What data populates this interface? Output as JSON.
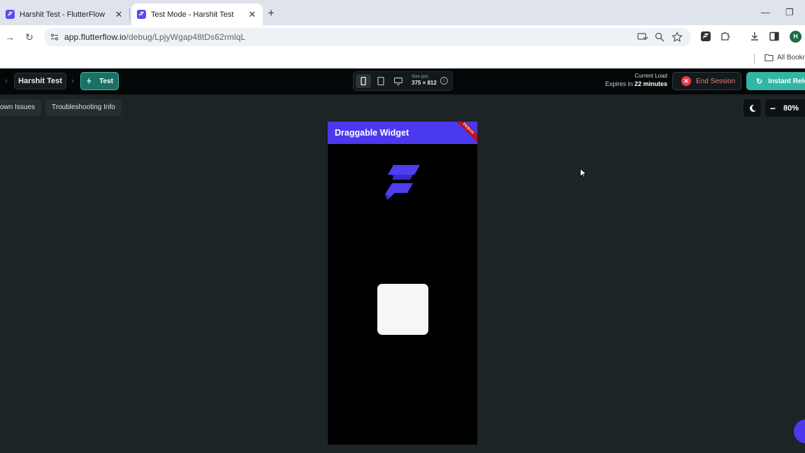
{
  "browser": {
    "tabs": [
      {
        "title": "Harshit Test - FlutterFlow",
        "active": false
      },
      {
        "title": "Test Mode - Harshit Test",
        "active": true
      }
    ],
    "url_host": "app.flutterflow.io",
    "url_path": "/debug/LpjyWgap48tDs62rmlqL",
    "profile_initial": "H",
    "bookmarks_label": "All Bookm"
  },
  "ff_header": {
    "project_name": "Harshit Test",
    "mode_label": "Test",
    "size_label": "Size (px)",
    "size_value": "375 × 812",
    "load_label": "Current Load",
    "expires_prefix": "Expires in",
    "expires_value": "22 minutes",
    "end_session_label": "End Session",
    "reload_label": "Instant Relo"
  },
  "toolbar2": {
    "known_issues_label": "own Issues",
    "troubleshooting_label": "Troubleshooting Info",
    "zoom_value": "80%"
  },
  "app_preview": {
    "appbar_title": "Draggable Widget",
    "debug_banner": "DEBUG"
  },
  "colors": {
    "accent": "#4b39ef",
    "teal": "#31b6a5",
    "danger": "#ef3b45"
  }
}
